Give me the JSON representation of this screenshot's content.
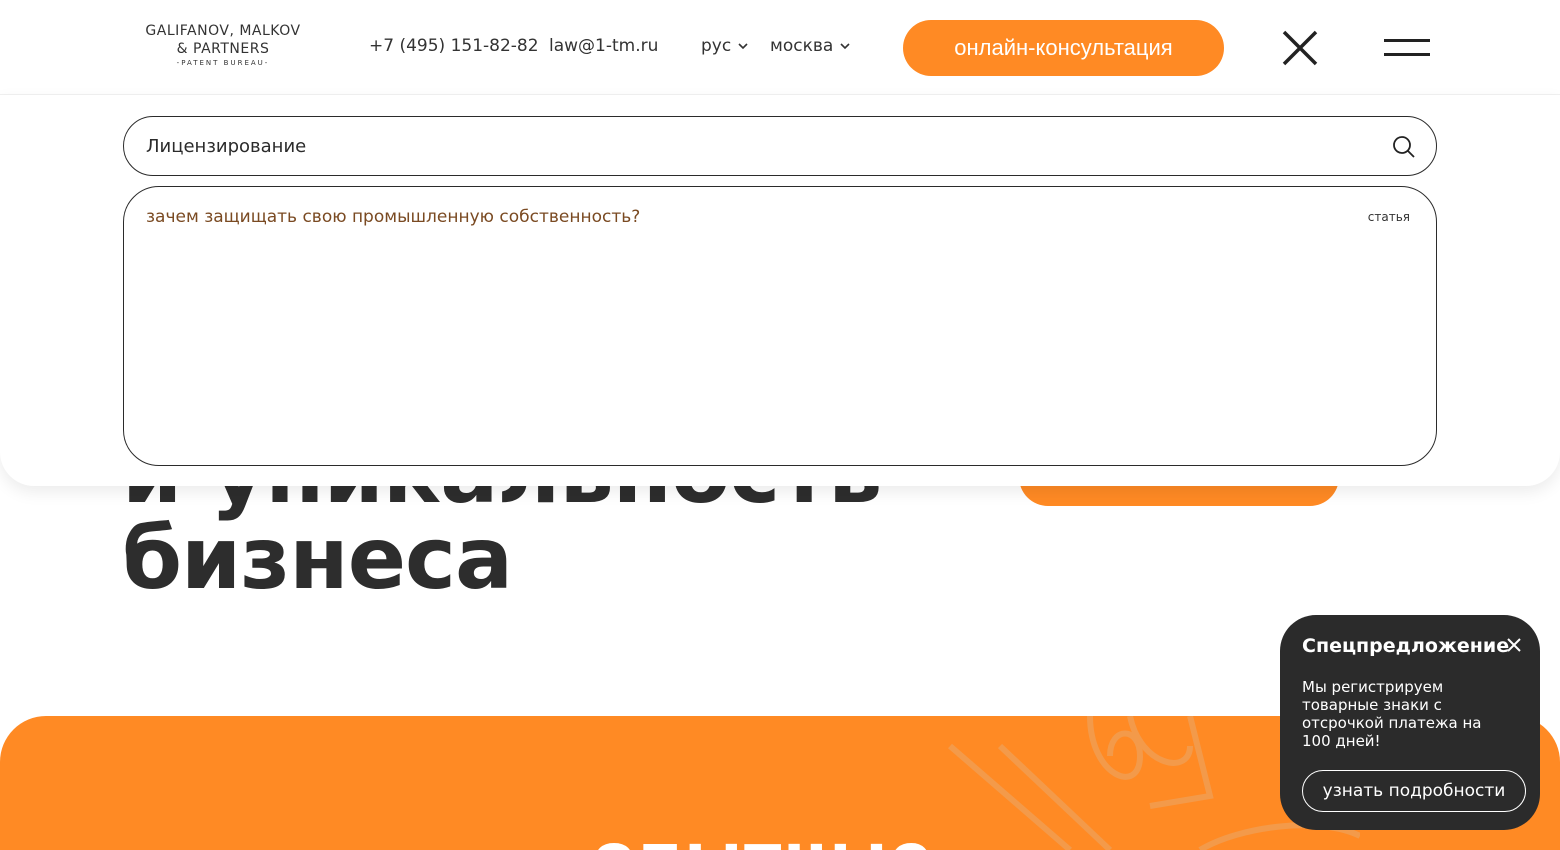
{
  "header": {
    "logo": {
      "line1": "GALIFANOV, MALKOV",
      "line2": "& PARTNERS",
      "sub": "-PATENT BUREAU-"
    },
    "phone": "+7 (495) 151-82-82",
    "email": "law@1-tm.ru",
    "language": "рус",
    "city": "москва",
    "consult_button": "онлайн-консультация"
  },
  "search": {
    "query": "Лицензирование",
    "results": [
      {
        "title": "зачем защищать свою промышленную собственность?",
        "type": "статья"
      }
    ]
  },
  "hero": {
    "title_lines": [
      "и уникальность",
      "бизнеса"
    ]
  },
  "section": {
    "heading_partial": "опытные"
  },
  "offer": {
    "title": "Спецпредложение",
    "text": "Мы регистрируем товарные знаки с отсрочкой платежа на 100 дней!",
    "button": "узнать подробности"
  },
  "colors": {
    "accent": "#ff8a24",
    "dark": "#2b2b2b",
    "result_link": "#7a4a22"
  }
}
